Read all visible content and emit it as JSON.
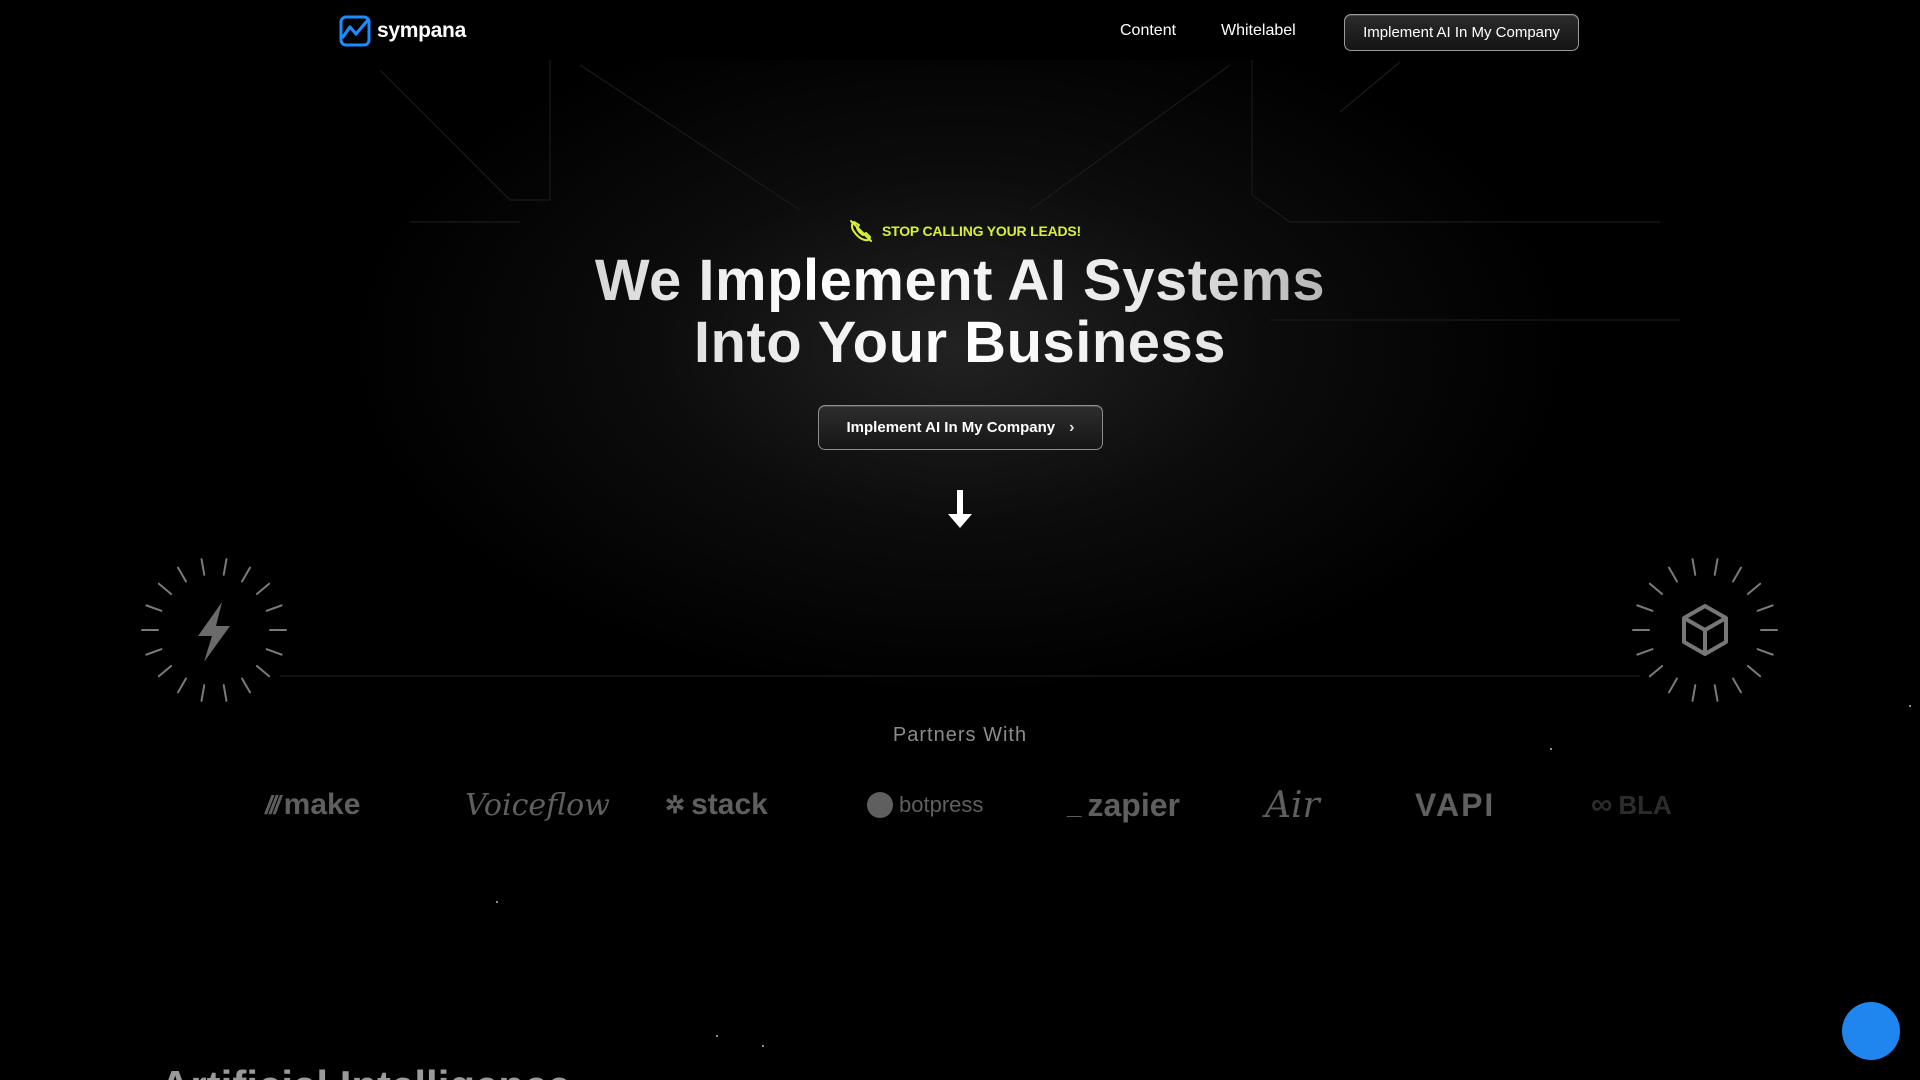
{
  "brand": {
    "name": "sympana",
    "accent": "#1f8bff"
  },
  "nav": {
    "links": [
      "Content",
      "Whitelabel"
    ],
    "cta_label": "Implement AI In My Company"
  },
  "hero": {
    "eyebrow": "STOP CALLING YOUR LEADS!",
    "eyebrow_color": "#d8f03b",
    "headline_line1": "We Implement AI Systems",
    "headline_line2": "Into Your Business",
    "cta_label": "Implement AI In My Company",
    "cta_icon": "chevron-right-icon",
    "scroll_icon": "arrow-down-icon"
  },
  "decor": {
    "left_icon": "lightning-icon",
    "right_icon": "cube-icon"
  },
  "partners": {
    "title": "Partners With",
    "items": [
      "make",
      "Voiceflow",
      "stack",
      "botpress",
      "zapier",
      "Air",
      "VAPI",
      "BLA"
    ]
  },
  "section_heading": "Artificial Intelligence",
  "chat": {
    "icon": "chat-bubble-icon",
    "color": "#1f86f0"
  }
}
